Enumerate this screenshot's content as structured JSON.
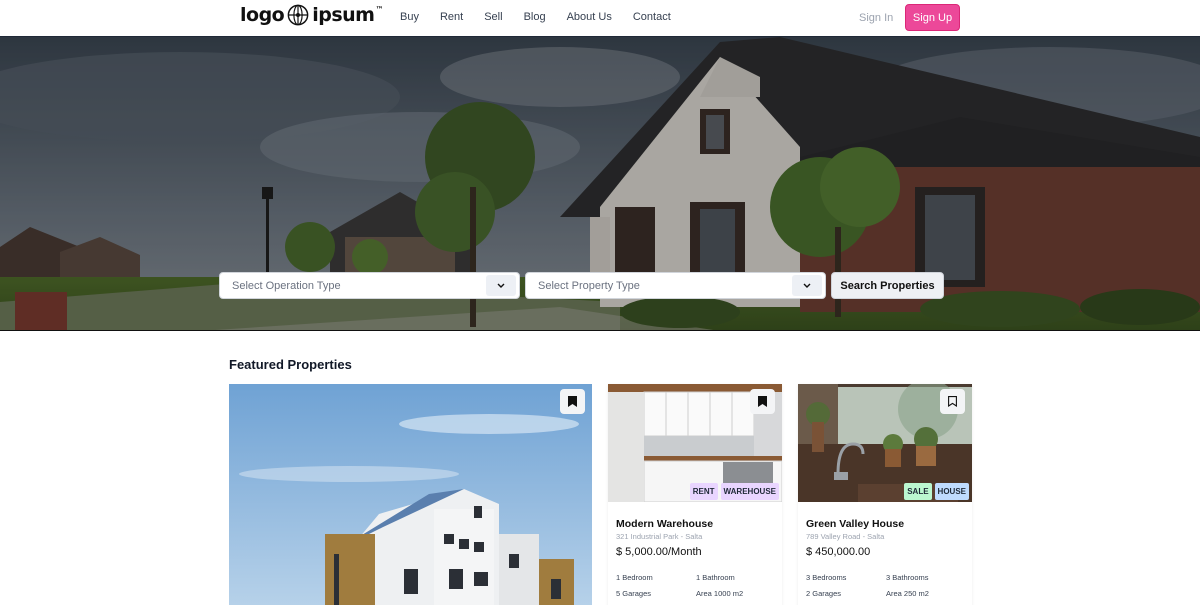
{
  "nav": {
    "logo_left": "logo",
    "logo_right": "ipsum",
    "logo_tm": "™",
    "menu": [
      "Buy",
      "Rent",
      "Sell",
      "Blog",
      "About Us",
      "Contact"
    ],
    "sign_in": "Sign In",
    "sign_up": "Sign Up"
  },
  "search": {
    "operation_placeholder": "Select Operation Type",
    "property_placeholder": "Select Property Type",
    "button": "Search Properties"
  },
  "featured": {
    "title": "Featured Properties",
    "cards": [
      {
        "title": "Modern Warehouse",
        "address": "321 Industrial Park - Salta",
        "price": "$ 5,000.00/Month",
        "tags": [
          "RENT",
          "WAREHOUSE"
        ],
        "features": [
          "1 Bedroom",
          "1 Bathroom",
          "5 Garages",
          "Area 1000 m2"
        ],
        "bookmarked": true
      },
      {
        "title": "Green Valley House",
        "address": "789 Valley Road - Salta",
        "price": "$ 450,000.00",
        "tags": [
          "SALE",
          "HOUSE"
        ],
        "features": [
          "3 Bedrooms",
          "3 Bathrooms",
          "2 Garages",
          "Area 250 m2"
        ],
        "bookmarked": false
      }
    ]
  },
  "colors": {
    "accent": "#ec4899",
    "tag_rent": "#e9d5ff",
    "tag_sale": "#bbf7d0",
    "tag_house": "#bfdbfe"
  },
  "icons": [
    "globe-icon",
    "chevron-down-icon",
    "bookmark-filled-icon",
    "bookmark-outline-icon"
  ]
}
